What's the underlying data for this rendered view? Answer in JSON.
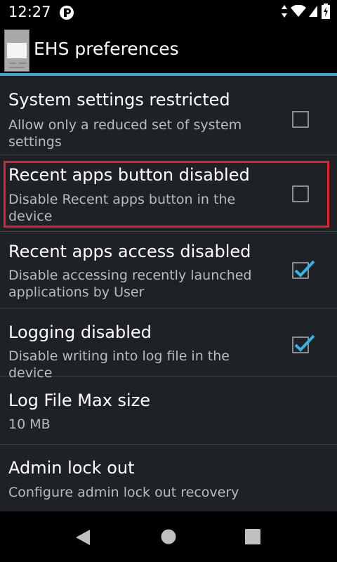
{
  "status_bar": {
    "time": "12:27",
    "icons": [
      "notification-icon",
      "data-arrows-icon",
      "wifi-icon",
      "signal-icon",
      "battery-charging-icon"
    ]
  },
  "app_bar": {
    "title": "EHS preferences",
    "icon": "app-icon",
    "underline_color": "#40a3d1"
  },
  "preferences": [
    {
      "title": "System settings restricted",
      "summary": "Allow only a reduced set of system settings",
      "checked": false,
      "highlighted": false
    },
    {
      "title": "Recent apps button disabled",
      "summary": "Disable Recent apps button in the device",
      "checked": false,
      "highlighted": true
    },
    {
      "title": "Recent apps access disabled",
      "summary": "Disable accessing recently launched applications by User",
      "checked": true,
      "highlighted": false
    },
    {
      "title": "Logging disabled",
      "summary": "Disable writing into log file in the device",
      "checked": true,
      "highlighted": false
    },
    {
      "title": "Log File Max size",
      "summary": "10 MB",
      "highlighted": false
    },
    {
      "title": "Admin lock out",
      "summary": "Configure admin lock out recovery",
      "highlighted": false
    }
  ],
  "colors": {
    "highlight": "#e0202a",
    "check": "#33b5e5"
  },
  "nav_bar": {
    "icons": [
      "back-icon",
      "home-icon",
      "recents-icon"
    ]
  }
}
